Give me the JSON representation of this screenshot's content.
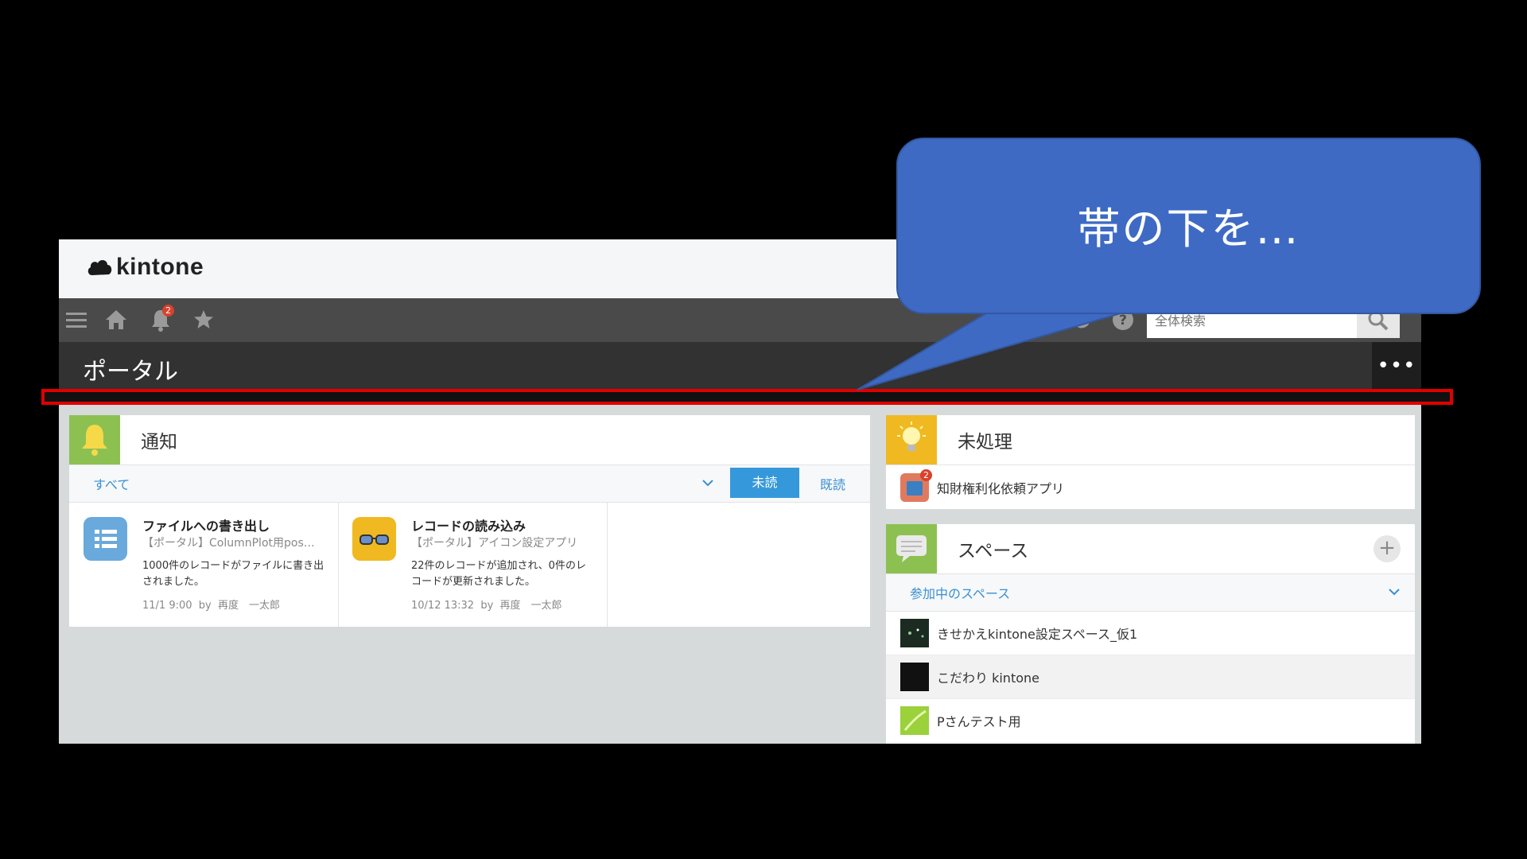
{
  "app": {
    "logo_text": "kintone"
  },
  "toolbar": {
    "notification_count": "2",
    "search_placeholder": "全体検索"
  },
  "page": {
    "title": "ポータル",
    "more_label": "•••"
  },
  "notifications": {
    "title": "通知",
    "filter_label": "すべて",
    "unread_label": "未読",
    "read_label": "既読",
    "items": [
      {
        "title": "ファイルへの書き出し",
        "app": "【ポータル】ColumnPlot用pos…",
        "body": "1000件のレコードがファイルに書き出されました。",
        "time": "11/1 9:00",
        "by": "by",
        "user": "再度　一太郎"
      },
      {
        "title": "レコードの読み込み",
        "app": "【ポータル】アイコン設定アプリ",
        "body": "22件のレコードが追加され、0件のレコードが更新されました。",
        "time": "10/12 13:32",
        "by": "by",
        "user": "再度　一太郎"
      }
    ]
  },
  "tasks": {
    "title": "未処理",
    "items": [
      {
        "label": "知財権利化依頼アプリ",
        "count": "2"
      }
    ]
  },
  "spaces": {
    "title": "スペース",
    "add_label": "+",
    "filter_label": "参加中のスペース",
    "items": [
      {
        "label": "きせかえkintone設定スペース_仮1"
      },
      {
        "label": "こだわり kintone"
      },
      {
        "label": "Pさんテスト用"
      }
    ]
  },
  "callout": {
    "text": "帯の下を…"
  }
}
